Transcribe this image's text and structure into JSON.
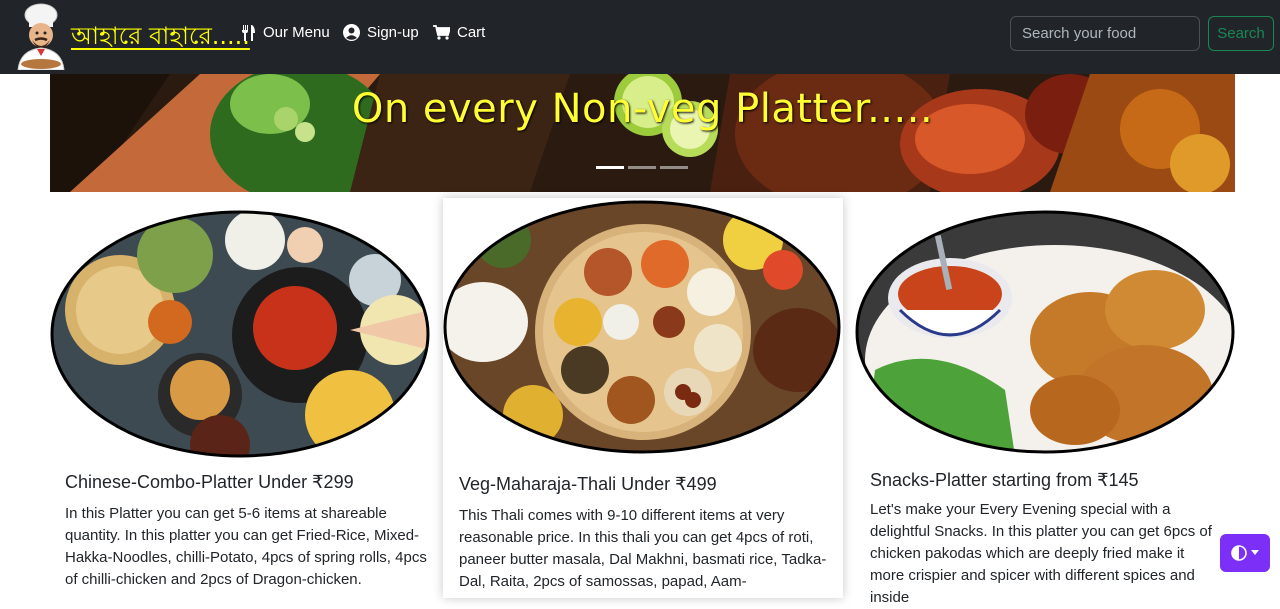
{
  "navbar": {
    "brand": "আহারে বাহারে.....",
    "links": [
      {
        "label": "Our Menu",
        "icon": "utensils-icon"
      },
      {
        "label": "Sign-up",
        "icon": "user-circle-icon"
      },
      {
        "label": "Cart",
        "icon": "cart-icon"
      }
    ],
    "search": {
      "placeholder": "Search your food",
      "button_label": "Search"
    }
  },
  "carousel": {
    "caption": "On every Non-veg Platter.....",
    "slides": 3,
    "active_slide": 1
  },
  "cards": [
    {
      "title": "Chinese-Combo-Platter Under ₹299",
      "text": "In this Platter you can get 5-6 items at shareable quantity. In this platter you can get Fried-Rice, Mixed-Hakka-Noodles, chilli-Potato, 4pcs of spring rolls, 4pcs of chilli-chicken and 2pcs of Dragon-chicken."
    },
    {
      "title": "Veg-Maharaja-Thali Under ₹499",
      "text": "This Thali comes with 9-10 different items at very reasonable price. In this thali you can get 4pcs of roti, paneer butter masala, Dal Makhni, basmati rice, Tadka-Dal, Raita, 2pcs of samossas, papad, Aam-"
    },
    {
      "title": "Snacks-Platter starting from ₹145",
      "text": "Let's make your Every Evening special with a delightful Snacks. In this platter you can get 6pcs of chicken pakodas which are deeply fried make it more crispier and spicer with different spices and inside"
    }
  ],
  "colors": {
    "navbar_bg": "#212529",
    "brand": "#ffff00",
    "search_button": "#198754",
    "theme_toggle": "#7b2ff7"
  }
}
